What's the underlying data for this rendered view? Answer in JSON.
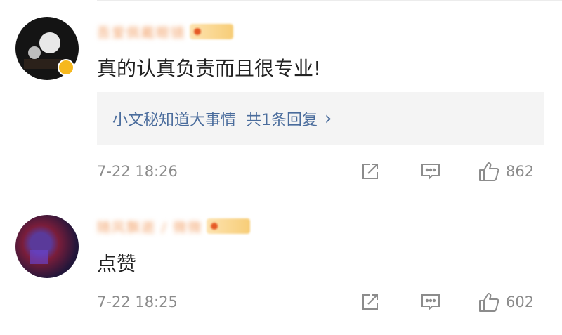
{
  "comments": [
    {
      "username": "吾爱佩戴眼镜",
      "text": "真的认真负责而且很专业!",
      "reply_summary": {
        "replier": "小文秘知道大事情",
        "count_text": "共1条回复",
        "arrow": "›"
      },
      "timestamp": "7-22 18:26",
      "likes": "862"
    },
    {
      "username": "随风飘逝 / 微微",
      "text": "点赞",
      "timestamp": "7-22 18:25",
      "likes": "602"
    }
  ],
  "icons": {
    "repost": "share-icon",
    "reply": "comment-icon",
    "like": "thumbs-up-icon"
  },
  "colors": {
    "link_blue": "#4a6c9c",
    "meta_gray": "#8c8c8c",
    "vip_gold": "#f6b81d",
    "name_orange": "#f2a26a"
  }
}
